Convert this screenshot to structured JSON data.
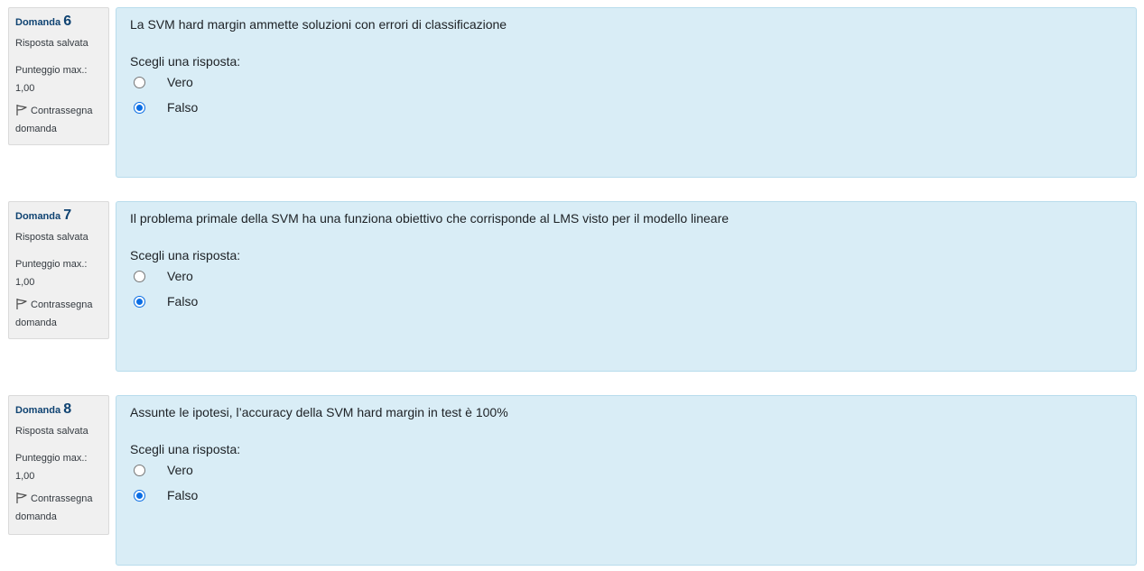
{
  "questions": [
    {
      "label": "Domanda",
      "number": "6",
      "state": "Risposta salvata",
      "grade_label": "Punteggio max.:",
      "grade_value": "1,00",
      "flag_label_1": "Contrassegna",
      "flag_label_2": "domanda",
      "text": "La SVM hard margin ammette soluzioni con errori di classificazione",
      "prompt": "Scegli una risposta:",
      "answers": [
        {
          "label": "Vero",
          "checked": false
        },
        {
          "label": "Falso",
          "checked": true
        }
      ]
    },
    {
      "label": "Domanda",
      "number": "7",
      "state": "Risposta salvata",
      "grade_label": "Punteggio max.:",
      "grade_value": "1,00",
      "flag_label_1": "Contrassegna",
      "flag_label_2": "domanda",
      "text": "Il problema primale della SVM ha una funziona obiettivo che corrisponde al LMS visto per il modello lineare",
      "prompt": "Scegli una risposta:",
      "answers": [
        {
          "label": "Vero",
          "checked": false
        },
        {
          "label": "Falso",
          "checked": true
        }
      ]
    },
    {
      "label": "Domanda",
      "number": "8",
      "state": "Risposta salvata",
      "grade_label": "Punteggio max.:",
      "grade_value": "1,00",
      "flag_label_1": "Contrassegna",
      "flag_label_2": "domanda",
      "text": "Assunte le ipotesi, l’accuracy della SVM hard margin in test  è 100%",
      "prompt": "Scegli una risposta:",
      "answers": [
        {
          "label": "Vero",
          "checked": false
        },
        {
          "label": "Falso",
          "checked": true
        }
      ]
    }
  ]
}
